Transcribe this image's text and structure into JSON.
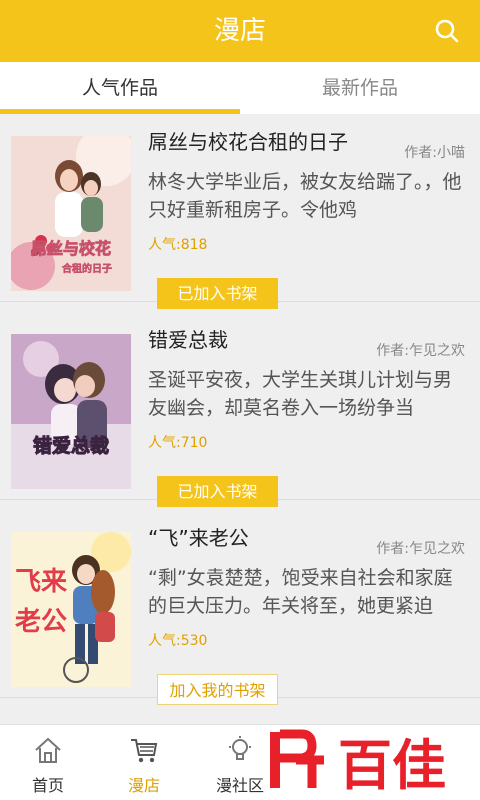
{
  "header": {
    "title": "漫店",
    "search_icon": "search-icon"
  },
  "tabs": [
    {
      "label": "人气作品",
      "active": true
    },
    {
      "label": "最新作品",
      "active": false
    }
  ],
  "items": [
    {
      "title": "屌丝与校花合租的日子",
      "author": "作者:小喵",
      "desc": "林冬大学毕业后，被女友给踹了。，他只好重新租房子。令他鸡",
      "popularity": "人气:818",
      "shelf_label": "已加入书架",
      "cover_text_1": "屌丝与校花",
      "cover_text_2": "合租的日子"
    },
    {
      "title": "错爱总裁",
      "author": "作者:乍见之欢",
      "desc": "圣诞平安夜，大学生关琪儿计划与男友幽会，却莫名卷入一场纷争当",
      "popularity": "人气:710",
      "shelf_label": "已加入书架",
      "cover_text_1": "错爱总裁"
    },
    {
      "title": "“飞”来老公",
      "author": "作者:乍见之欢",
      "desc": "“剩”女袁楚楚，饱受来自社会和家庭的巨大压力。年关将至，她更紧迫",
      "popularity": "人气:530",
      "shelf_label": "加入我的书架",
      "cover_text_1": "飞来",
      "cover_text_2": "老公"
    }
  ],
  "bottom_nav": [
    {
      "label": "首页",
      "icon": "home-icon",
      "active": false
    },
    {
      "label": "漫店",
      "icon": "cart-icon",
      "active": true
    },
    {
      "label": "漫社区",
      "icon": "bulb-icon",
      "active": false
    }
  ],
  "watermark": {
    "text": "百佳"
  },
  "colors": {
    "accent": "#f5c41a",
    "accent_text": "#e0a100",
    "background": "#efefef"
  }
}
